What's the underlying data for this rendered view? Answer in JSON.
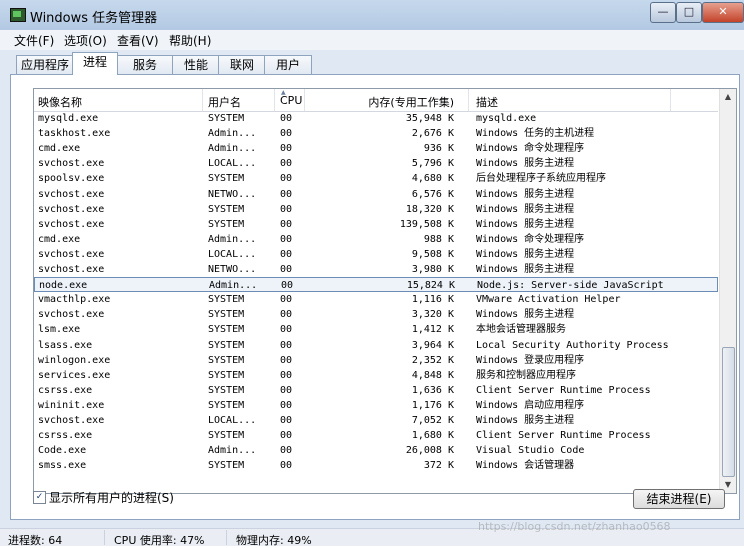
{
  "window": {
    "title": "Windows 任务管理器",
    "min": "—",
    "max": "□",
    "close": "✕"
  },
  "menu": [
    {
      "label": "文件(F)"
    },
    {
      "label": "选项(O)"
    },
    {
      "label": "查看(V)"
    },
    {
      "label": "帮助(H)"
    }
  ],
  "tabs": [
    {
      "label": "应用程序"
    },
    {
      "label": "进程",
      "active": true
    },
    {
      "label": "服务"
    },
    {
      "label": "性能"
    },
    {
      "label": "联网"
    },
    {
      "label": "用户"
    }
  ],
  "columns": {
    "name": "映像名称",
    "user": "用户名",
    "cpu": "CPU",
    "mem": "内存(专用工作集)",
    "desc": "描述"
  },
  "processes": [
    {
      "name": "mysqld.exe",
      "user": "SYSTEM",
      "cpu": "00",
      "mem": "35,948 K",
      "desc": "mysqld.exe"
    },
    {
      "name": "taskhost.exe",
      "user": "Admin...",
      "cpu": "00",
      "mem": "2,676 K",
      "desc": "Windows 任务的主机进程"
    },
    {
      "name": "cmd.exe",
      "user": "Admin...",
      "cpu": "00",
      "mem": "936 K",
      "desc": "Windows 命令处理程序"
    },
    {
      "name": "svchost.exe",
      "user": "LOCAL...",
      "cpu": "00",
      "mem": "5,796 K",
      "desc": "Windows 服务主进程"
    },
    {
      "name": "spoolsv.exe",
      "user": "SYSTEM",
      "cpu": "00",
      "mem": "4,680 K",
      "desc": "后台处理程序子系统应用程序"
    },
    {
      "name": "svchost.exe",
      "user": "NETWO...",
      "cpu": "00",
      "mem": "6,576 K",
      "desc": "Windows 服务主进程"
    },
    {
      "name": "svchost.exe",
      "user": "SYSTEM",
      "cpu": "00",
      "mem": "18,320 K",
      "desc": "Windows 服务主进程"
    },
    {
      "name": "svchost.exe",
      "user": "SYSTEM",
      "cpu": "00",
      "mem": "139,508 K",
      "desc": "Windows 服务主进程"
    },
    {
      "name": "cmd.exe",
      "user": "Admin...",
      "cpu": "00",
      "mem": "988 K",
      "desc": "Windows 命令处理程序"
    },
    {
      "name": "svchost.exe",
      "user": "LOCAL...",
      "cpu": "00",
      "mem": "9,508 K",
      "desc": "Windows 服务主进程"
    },
    {
      "name": "svchost.exe",
      "user": "NETWO...",
      "cpu": "00",
      "mem": "3,980 K",
      "desc": "Windows 服务主进程"
    },
    {
      "name": "node.exe",
      "user": "Admin...",
      "cpu": "00",
      "mem": "15,824 K",
      "desc": "Node.js: Server-side JavaScript",
      "selected": true
    },
    {
      "name": "vmacthlp.exe",
      "user": "SYSTEM",
      "cpu": "00",
      "mem": "1,116 K",
      "desc": "VMware Activation Helper"
    },
    {
      "name": "svchost.exe",
      "user": "SYSTEM",
      "cpu": "00",
      "mem": "3,320 K",
      "desc": "Windows 服务主进程"
    },
    {
      "name": "lsm.exe",
      "user": "SYSTEM",
      "cpu": "00",
      "mem": "1,412 K",
      "desc": "本地会话管理器服务"
    },
    {
      "name": "lsass.exe",
      "user": "SYSTEM",
      "cpu": "00",
      "mem": "3,964 K",
      "desc": "Local Security Authority Process"
    },
    {
      "name": "winlogon.exe",
      "user": "SYSTEM",
      "cpu": "00",
      "mem": "2,352 K",
      "desc": "Windows 登录应用程序"
    },
    {
      "name": "services.exe",
      "user": "SYSTEM",
      "cpu": "00",
      "mem": "4,848 K",
      "desc": "服务和控制器应用程序"
    },
    {
      "name": "csrss.exe",
      "user": "SYSTEM",
      "cpu": "00",
      "mem": "1,636 K",
      "desc": "Client Server Runtime Process"
    },
    {
      "name": "wininit.exe",
      "user": "SYSTEM",
      "cpu": "00",
      "mem": "1,176 K",
      "desc": "Windows 启动应用程序"
    },
    {
      "name": "svchost.exe",
      "user": "LOCAL...",
      "cpu": "00",
      "mem": "7,052 K",
      "desc": "Windows 服务主进程"
    },
    {
      "name": "csrss.exe",
      "user": "SYSTEM",
      "cpu": "00",
      "mem": "1,680 K",
      "desc": "Client Server Runtime Process"
    },
    {
      "name": "Code.exe",
      "user": "Admin...",
      "cpu": "00",
      "mem": "26,008 K",
      "desc": "Visual Studio Code"
    },
    {
      "name": "smss.exe",
      "user": "SYSTEM",
      "cpu": "00",
      "mem": "372 K",
      "desc": "Windows 会话管理器"
    }
  ],
  "showall": {
    "label": "显示所有用户的进程(S)",
    "checked": "✓"
  },
  "end_button": {
    "label": "结束进程(E)"
  },
  "status": {
    "process_count": "进程数: 64",
    "cpu_usage": "CPU 使用率: 47%",
    "physical_memory": "物理内存: 49%"
  },
  "watermark": "https://blog.csdn.net/zhanhao0568"
}
